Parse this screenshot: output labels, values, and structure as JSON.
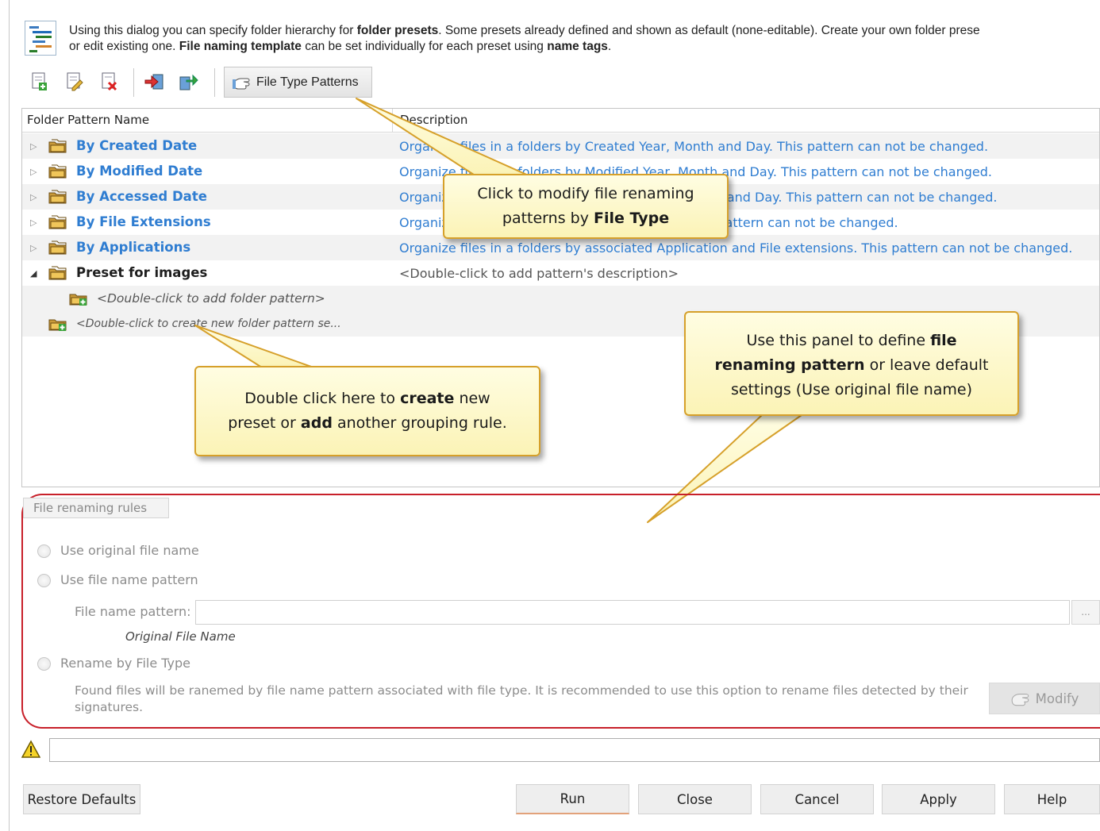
{
  "header": {
    "line1_a": "Using this dialog you can specify folder hierarchy for ",
    "line1_b": "folder presets",
    "line1_c": ". Some presets already defined and shown as default (none-editable). Create your own folder prese",
    "line2_a": "or edit existing one. ",
    "line2_b": "File naming template",
    "line2_c": " can be set individually for each preset using ",
    "line2_d": "name tags",
    "line2_e": "."
  },
  "toolbar": {
    "icons": [
      "add-preset-icon",
      "edit-preset-icon",
      "delete-preset-icon",
      "import-icon",
      "export-icon"
    ],
    "file_type_patterns_label": "File Type Patterns"
  },
  "grid": {
    "col_name": "Folder Pattern Name",
    "col_desc": "Description",
    "rows": [
      {
        "name": "By Created Date",
        "desc": "Organize files in a folders by Created Year, Month and Day. This pattern can not be changed."
      },
      {
        "name": "By Modified Date",
        "desc": "Organize files in a folders by Modified Year, Month and Day. This pattern can not be changed."
      },
      {
        "name": "By Accessed Date",
        "desc": "Organize files in a folders by Accessed Year, Month and Day. This pattern can not be changed."
      },
      {
        "name": "By File Extensions",
        "desc": "Organize files in a folders by File Extensions. This pattern can not be changed."
      },
      {
        "name": "By Applications",
        "desc": "Organize files in a folders by associated Application and File extensions. This pattern can not be changed."
      },
      {
        "name": "Preset for images",
        "desc": "<Double-click to add pattern's description>"
      }
    ],
    "add_pattern_hint": "<Double-click to add folder pattern>",
    "create_set_hint": "<Double-click to create new folder pattern se..."
  },
  "callouts": {
    "file_type": {
      "line1": "Click to modify file renaming",
      "line2_a": "patterns by ",
      "line2_b": "File Type"
    },
    "double_click": {
      "line1_a": "Double click here to ",
      "line1_b": "create",
      "line1_c": " new",
      "line2_a": "preset or ",
      "line2_b": "add",
      "line2_c": " another grouping rule."
    },
    "panel": {
      "line1_a": "Use this panel to define ",
      "line1_b": "file",
      "line2_a": "renaming pattern",
      "line2_b": " or leave default",
      "line3": "settings (Use original file name)"
    }
  },
  "rules": {
    "legend": "File renaming rules",
    "use_original": "Use original file name",
    "use_pattern": "Use file name pattern",
    "pattern_label": "File name pattern:",
    "pattern_value": "",
    "browse": "...",
    "original_hint": "Original File Name",
    "rename_by_type": "Rename by File Type",
    "found_text": "Found files will be ranemed by file name pattern associated with file type. It is recommended to use this option to rename files detected by their signatures.",
    "modify": "Modify"
  },
  "status": {
    "text": ""
  },
  "buttons": {
    "restore": "Restore Defaults",
    "run": "Run",
    "close": "Close",
    "cancel": "Cancel",
    "apply": "Apply",
    "help": "Help"
  }
}
